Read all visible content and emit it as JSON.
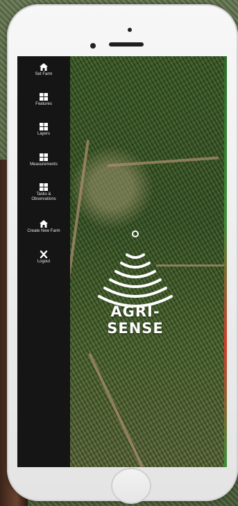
{
  "sidebar": {
    "items": [
      {
        "label": "Set Farm",
        "icon": "home-icon"
      },
      {
        "label": "Features",
        "icon": "grid-icon"
      },
      {
        "label": "Layers",
        "icon": "grid-icon"
      },
      {
        "label": "Measurements",
        "icon": "grid-icon"
      },
      {
        "label": "Tasks &\nObservations",
        "icon": "grid-icon"
      },
      {
        "label": "Create New Farm",
        "icon": "home-icon"
      },
      {
        "label": "Logout",
        "icon": "close-icon"
      }
    ]
  },
  "brand": {
    "name": "AGRI-SENSE",
    "logo_icon": "signal-waves-icon"
  },
  "colors": {
    "sidebar_bg": "#151515",
    "text": "#ffffff"
  }
}
